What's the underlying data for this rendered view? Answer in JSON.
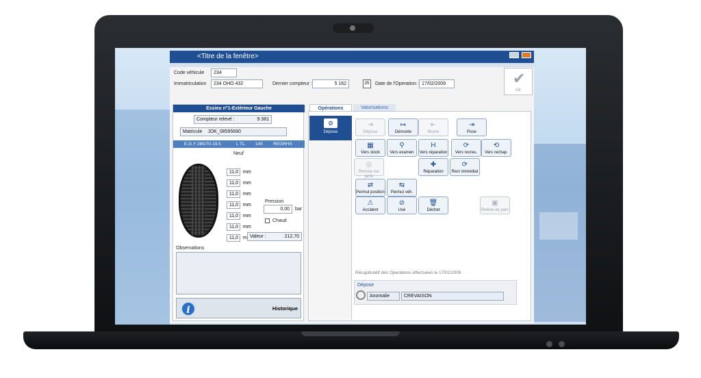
{
  "window": {
    "title": "<Titre de la fenêtre>"
  },
  "header": {
    "code_vehicule_label": "Code véhicule",
    "code_vehicule_value": "234",
    "immatriculation_label": "Immatriculation",
    "immatriculation_value": "234 OHO 432",
    "dernier_compteur_label": "Dernier compteur :",
    "dernier_compteur_value": "5 162",
    "date_operation_label": "Date de l'Operation :",
    "date_operation_value": "17/02/2009",
    "calendar_day": "25",
    "ok_label": "Ok"
  },
  "left_panel": {
    "title": "Essieu n°1-Extérieur Gauche",
    "compteur_label": "Compteur relevé :",
    "compteur_value": "9 381",
    "matricule_label": "Matricule",
    "matricule_value": "JOK_08595690",
    "spec": {
      "brand": "E.G.Y 285/70-19.5",
      "code": "L TL",
      "index": "145",
      "model": "REGRHS"
    },
    "etat": "Neuf",
    "depths": [
      "11,0",
      "11,0",
      "11,0",
      "11,0",
      "11,0",
      "11,0",
      "11,0"
    ],
    "depth_unit": "mm",
    "pression_label": "Pression",
    "pression_value": "0,00",
    "pression_unit": "bar",
    "chaud_label": "Chaud",
    "valeur_label": "Valeur :",
    "valeur_value": "212,70",
    "observations_label": "Observations",
    "historique_label": "Historique",
    "info_glyph": "i"
  },
  "tabs": {
    "operations": "Opérations",
    "valorisations": "Valorisations"
  },
  "sidebar": {
    "active_label": "Dépose"
  },
  "operations": [
    {
      "label": "Dépose",
      "enabled": false
    },
    {
      "label": "Démonte",
      "enabled": true
    },
    {
      "label": "Monte",
      "enabled": false
    },
    {
      "label": "Pose",
      "enabled": true
    },
    {
      "label": "Vers stock",
      "enabled": true
    },
    {
      "label": "Vers examen",
      "enabled": true
    },
    {
      "label": "Vers réparation",
      "enabled": true
    },
    {
      "label": "Vers recreu.",
      "enabled": true
    },
    {
      "label": "Vers rechap.",
      "enabled": true
    },
    {
      "label": "Remise sur jante",
      "enabled": false
    },
    {
      "label": "Réparation",
      "enabled": true
    },
    {
      "label": "Recr immédiat",
      "enabled": true
    },
    {
      "label": "Permut position",
      "enabled": true
    },
    {
      "label": "Permut véh.",
      "enabled": true
    },
    {
      "label": "Accident",
      "enabled": true
    },
    {
      "label": "Usé",
      "enabled": true
    },
    {
      "label": "Déchet",
      "enabled": true
    },
    {
      "label": "Relève de parc",
      "enabled": false
    }
  ],
  "recap": {
    "title": "Récapitulatif des Operations effectuées le 17/02/2009",
    "section": "Dépose",
    "anomalie_label": "Anomalie",
    "anomalie_value": "CREVAISON"
  }
}
